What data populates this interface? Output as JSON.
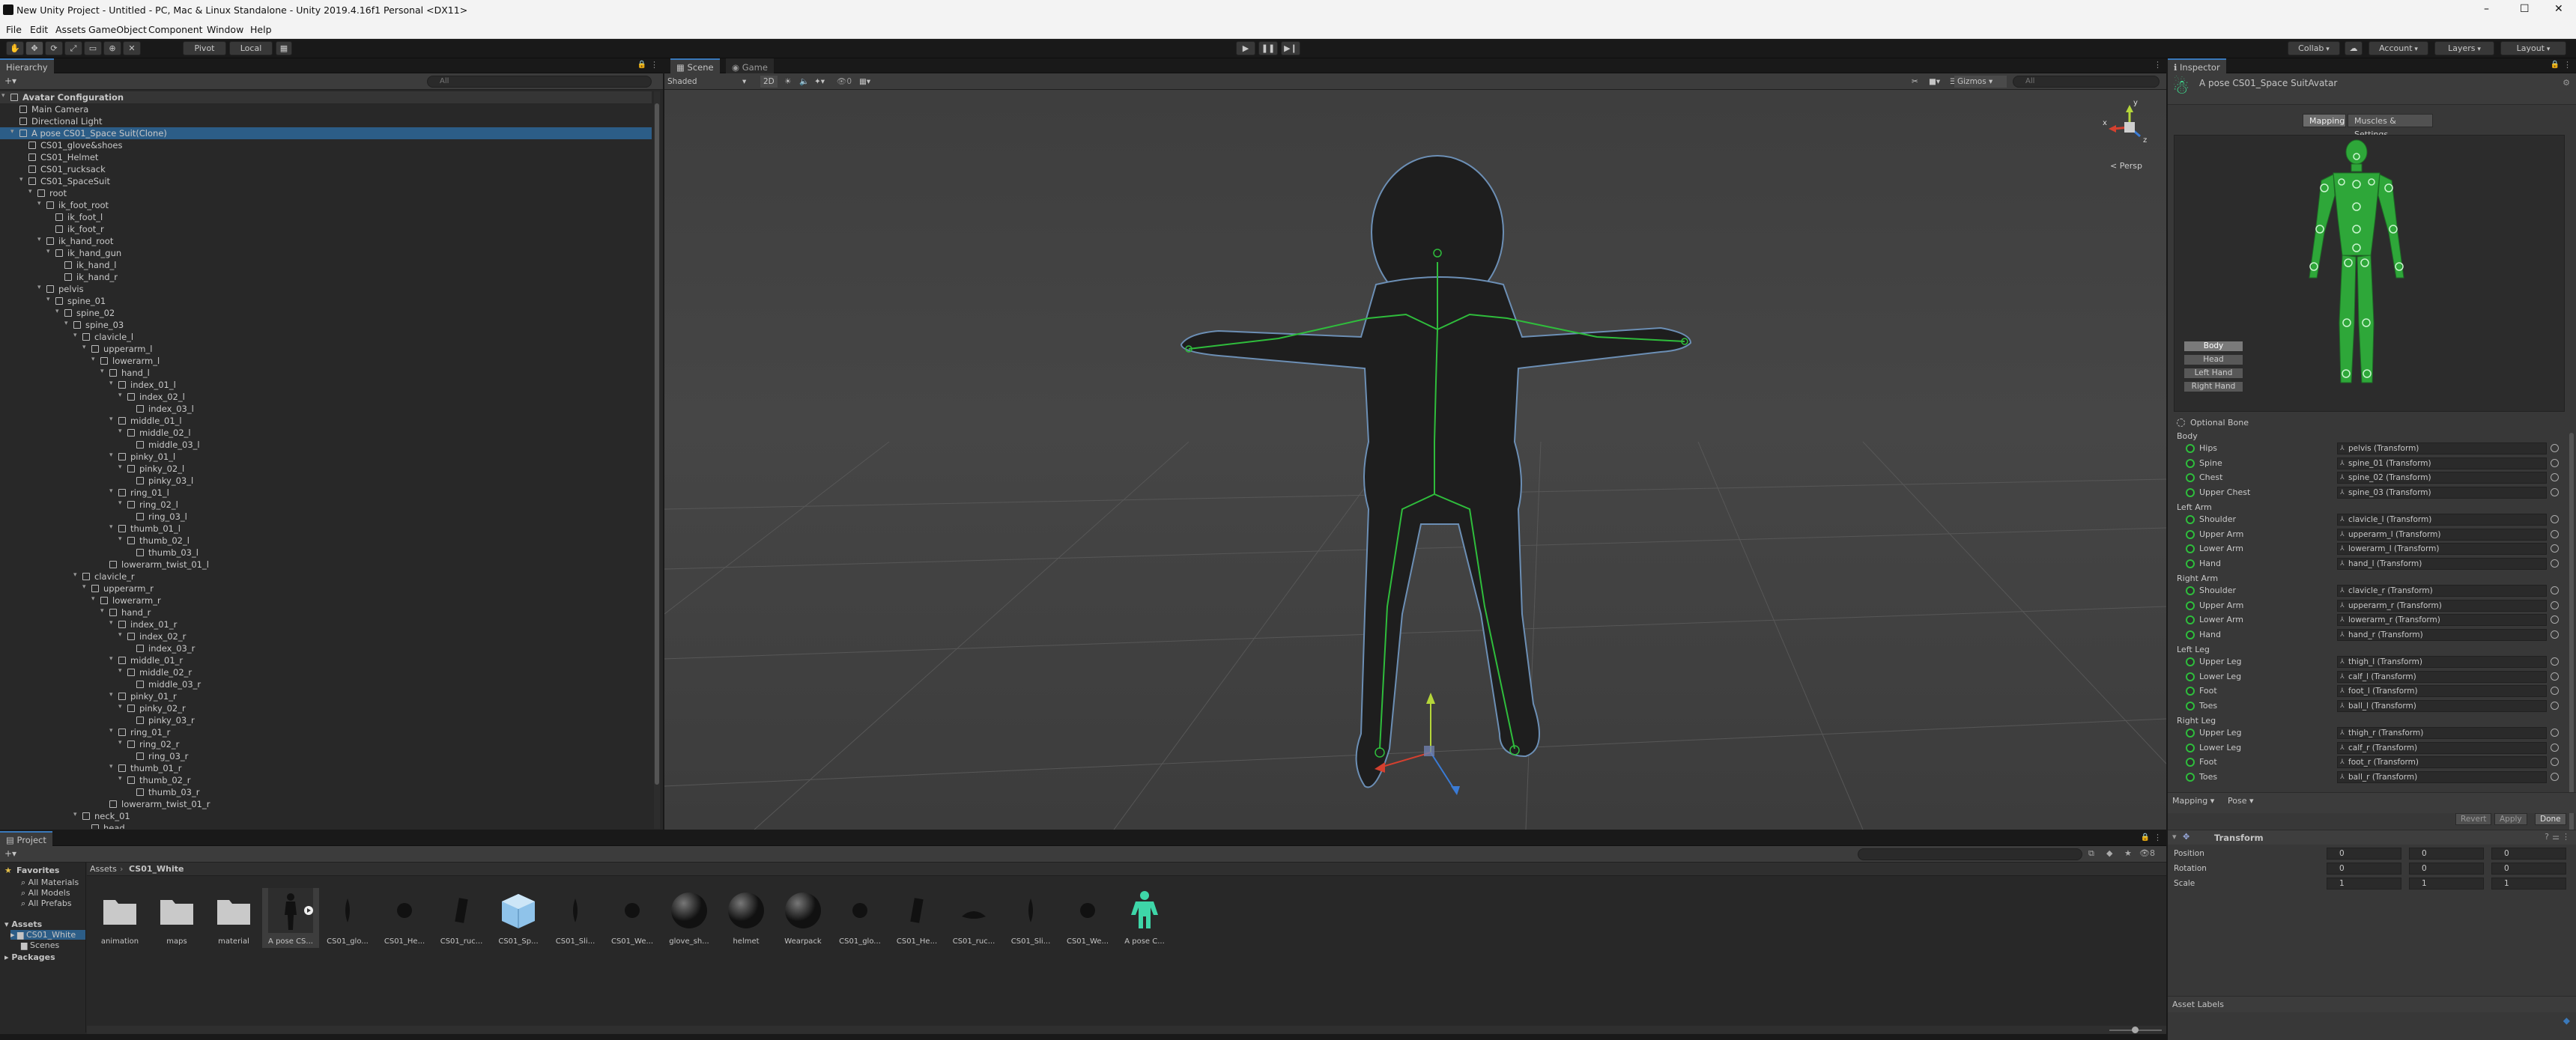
{
  "window": {
    "title": "New Unity Project - Untitled - PC, Mac & Linux Standalone - Unity 2019.4.16f1 Personal <DX11>",
    "controls": [
      "–",
      "☐",
      "✕"
    ]
  },
  "menu": [
    "File",
    "Edit",
    "Assets",
    "GameObject",
    "Component",
    "Window",
    "Help"
  ],
  "toolbar": {
    "pivot": "Pivot",
    "local": "Local",
    "collab": "Collab",
    "account": "Account",
    "layers": "Layers",
    "layout": "Layout"
  },
  "hierarchy": {
    "tab": "Hierarchy",
    "search_placeholder": "All",
    "rows": [
      {
        "label": "Avatar Configuration",
        "depth": 0,
        "expanded": true,
        "root": true
      },
      {
        "label": "Main Camera",
        "depth": 1
      },
      {
        "label": "Directional Light",
        "depth": 1
      },
      {
        "label": "A pose CS01_Space Suit(Clone)",
        "depth": 1,
        "expanded": true,
        "selected": true
      },
      {
        "label": "CS01_glove&shoes",
        "depth": 2
      },
      {
        "label": "CS01_Helmet",
        "depth": 2
      },
      {
        "label": "CS01_rucksack",
        "depth": 2
      },
      {
        "label": "CS01_SpaceSuit",
        "depth": 2,
        "expanded": true
      },
      {
        "label": "root",
        "depth": 3,
        "expanded": true
      },
      {
        "label": "ik_foot_root",
        "depth": 4,
        "expanded": true
      },
      {
        "label": "ik_foot_l",
        "depth": 5
      },
      {
        "label": "ik_foot_r",
        "depth": 5
      },
      {
        "label": "ik_hand_root",
        "depth": 4,
        "expanded": true
      },
      {
        "label": "ik_hand_gun",
        "depth": 5,
        "expanded": true
      },
      {
        "label": "ik_hand_l",
        "depth": 6
      },
      {
        "label": "ik_hand_r",
        "depth": 6
      },
      {
        "label": "pelvis",
        "depth": 4,
        "expanded": true
      },
      {
        "label": "spine_01",
        "depth": 5,
        "expanded": true
      },
      {
        "label": "spine_02",
        "depth": 6,
        "expanded": true
      },
      {
        "label": "spine_03",
        "depth": 7,
        "expanded": true
      },
      {
        "label": "clavicle_l",
        "depth": 8,
        "expanded": true
      },
      {
        "label": "upperarm_l",
        "depth": 9,
        "expanded": true
      },
      {
        "label": "lowerarm_l",
        "depth": 10,
        "expanded": true
      },
      {
        "label": "hand_l",
        "depth": 11,
        "expanded": true
      },
      {
        "label": "index_01_l",
        "depth": 12,
        "expanded": true
      },
      {
        "label": "index_02_l",
        "depth": 13,
        "expanded": true
      },
      {
        "label": "index_03_l",
        "depth": 14
      },
      {
        "label": "middle_01_l",
        "depth": 12,
        "expanded": true
      },
      {
        "label": "middle_02_l",
        "depth": 13,
        "expanded": true
      },
      {
        "label": "middle_03_l",
        "depth": 14
      },
      {
        "label": "pinky_01_l",
        "depth": 12,
        "expanded": true
      },
      {
        "label": "pinky_02_l",
        "depth": 13,
        "expanded": true
      },
      {
        "label": "pinky_03_l",
        "depth": 14
      },
      {
        "label": "ring_01_l",
        "depth": 12,
        "expanded": true
      },
      {
        "label": "ring_02_l",
        "depth": 13,
        "expanded": true
      },
      {
        "label": "ring_03_l",
        "depth": 14
      },
      {
        "label": "thumb_01_l",
        "depth": 12,
        "expanded": true
      },
      {
        "label": "thumb_02_l",
        "depth": 13,
        "expanded": true
      },
      {
        "label": "thumb_03_l",
        "depth": 14
      },
      {
        "label": "lowerarm_twist_01_l",
        "depth": 11
      },
      {
        "label": "clavicle_r",
        "depth": 8,
        "expanded": true
      },
      {
        "label": "upperarm_r",
        "depth": 9,
        "expanded": true
      },
      {
        "label": "lowerarm_r",
        "depth": 10,
        "expanded": true
      },
      {
        "label": "hand_r",
        "depth": 11,
        "expanded": true
      },
      {
        "label": "index_01_r",
        "depth": 12,
        "expanded": true
      },
      {
        "label": "index_02_r",
        "depth": 13,
        "expanded": true
      },
      {
        "label": "index_03_r",
        "depth": 14
      },
      {
        "label": "middle_01_r",
        "depth": 12,
        "expanded": true
      },
      {
        "label": "middle_02_r",
        "depth": 13,
        "expanded": true
      },
      {
        "label": "middle_03_r",
        "depth": 14
      },
      {
        "label": "pinky_01_r",
        "depth": 12,
        "expanded": true
      },
      {
        "label": "pinky_02_r",
        "depth": 13,
        "expanded": true
      },
      {
        "label": "pinky_03_r",
        "depth": 14
      },
      {
        "label": "ring_01_r",
        "depth": 12,
        "expanded": true
      },
      {
        "label": "ring_02_r",
        "depth": 13,
        "expanded": true
      },
      {
        "label": "ring_03_r",
        "depth": 14
      },
      {
        "label": "thumb_01_r",
        "depth": 12,
        "expanded": true
      },
      {
        "label": "thumb_02_r",
        "depth": 13,
        "expanded": true
      },
      {
        "label": "thumb_03_r",
        "depth": 14
      },
      {
        "label": "lowerarm_twist_01_r",
        "depth": 11
      },
      {
        "label": "neck_01",
        "depth": 8,
        "expanded": true
      },
      {
        "label": "head",
        "depth": 9
      }
    ]
  },
  "scene": {
    "tabs": [
      "Scene",
      "Game"
    ],
    "shading": "Shaded",
    "mode_2d": "2D",
    "gizmos": "Gizmos",
    "search_placeholder": "All",
    "fx_count": "0",
    "projection": "< Persp",
    "gizmo_axes": {
      "y": "y",
      "x": "x",
      "z": "z"
    }
  },
  "inspector": {
    "tab": "Inspector",
    "title": "A pose CS01_Space SuitAvatar",
    "tabs": [
      "Mapping",
      "Muscles & Settings"
    ],
    "body_buttons": [
      "Body",
      "Head",
      "Left Hand",
      "Right Hand"
    ],
    "optional_bone": "Optional Bone",
    "groups": [
      {
        "name": "Body",
        "bones": [
          {
            "name": "Hips",
            "transform": "pelvis (Transform)"
          },
          {
            "name": "Spine",
            "transform": "spine_01 (Transform)"
          },
          {
            "name": "Chest",
            "transform": "spine_02 (Transform)"
          },
          {
            "name": "Upper Chest",
            "transform": "spine_03 (Transform)"
          }
        ]
      },
      {
        "name": "Left Arm",
        "bones": [
          {
            "name": "Shoulder",
            "transform": "clavicle_l (Transform)"
          },
          {
            "name": "Upper Arm",
            "transform": "upperarm_l (Transform)"
          },
          {
            "name": "Lower Arm",
            "transform": "lowerarm_l (Transform)"
          },
          {
            "name": "Hand",
            "transform": "hand_l (Transform)"
          }
        ]
      },
      {
        "name": "Right Arm",
        "bones": [
          {
            "name": "Shoulder",
            "transform": "clavicle_r (Transform)"
          },
          {
            "name": "Upper Arm",
            "transform": "upperarm_r (Transform)"
          },
          {
            "name": "Lower Arm",
            "transform": "lowerarm_r (Transform)"
          },
          {
            "name": "Hand",
            "transform": "hand_r (Transform)"
          }
        ]
      },
      {
        "name": "Left Leg",
        "bones": [
          {
            "name": "Upper Leg",
            "transform": "thigh_l (Transform)"
          },
          {
            "name": "Lower Leg",
            "transform": "calf_l (Transform)"
          },
          {
            "name": "Foot",
            "transform": "foot_l (Transform)"
          },
          {
            "name": "Toes",
            "transform": "ball_l (Transform)"
          }
        ]
      },
      {
        "name": "Right Leg",
        "bones": [
          {
            "name": "Upper Leg",
            "transform": "thigh_r (Transform)"
          },
          {
            "name": "Lower Leg",
            "transform": "calf_r (Transform)"
          },
          {
            "name": "Foot",
            "transform": "foot_r (Transform)"
          },
          {
            "name": "Toes",
            "transform": "ball_r (Transform)"
          }
        ]
      }
    ],
    "mapping_dropdown": "Mapping",
    "pose_dropdown": "Pose",
    "revert": "Revert",
    "apply": "Apply",
    "done": "Done",
    "transform": {
      "title": "Transform",
      "position_label": "Position",
      "position": {
        "x": "0",
        "y": "0",
        "z": "0"
      },
      "rotation_label": "Rotation",
      "rotation": {
        "x": "0",
        "y": "0",
        "z": "0"
      },
      "scale_label": "Scale",
      "scale": {
        "x": "1",
        "y": "1",
        "z": "1"
      }
    },
    "asset_labels": "Asset Labels"
  },
  "project": {
    "tab": "Project",
    "favorites": "Favorites",
    "favorites_items": [
      "All Materials",
      "All Models",
      "All Prefabs"
    ],
    "assets_root": "Assets",
    "tree": [
      "CS01_White",
      "Scenes"
    ],
    "packages": "Packages",
    "breadcrumb": [
      "Assets",
      "CS01_White"
    ],
    "items": [
      {
        "label": "animation",
        "kind": "folder"
      },
      {
        "label": "maps",
        "kind": "folder"
      },
      {
        "label": "material",
        "kind": "folder"
      },
      {
        "label": "A pose CS...",
        "kind": "model",
        "selected": true
      },
      {
        "label": "CS01_glo...",
        "kind": "mesh"
      },
      {
        "label": "CS01_He...",
        "kind": "mesh"
      },
      {
        "label": "CS01_ruc...",
        "kind": "mesh"
      },
      {
        "label": "CS01_Sp...",
        "kind": "prefab"
      },
      {
        "label": "CS01_Sli...",
        "kind": "mesh"
      },
      {
        "label": "CS01_We...",
        "kind": "mesh"
      },
      {
        "label": "glove_sh...",
        "kind": "sphere"
      },
      {
        "label": "helmet",
        "kind": "sphere"
      },
      {
        "label": "Wearpack",
        "kind": "sphere"
      },
      {
        "label": "CS01_glo...",
        "kind": "mesh"
      },
      {
        "label": "CS01_He...",
        "kind": "mesh"
      },
      {
        "label": "CS01_ruc...",
        "kind": "mesh"
      },
      {
        "label": "CS01_Sli...",
        "kind": "mesh"
      },
      {
        "label": "CS01_We...",
        "kind": "mesh"
      },
      {
        "label": "A pose C...",
        "kind": "avatar"
      }
    ],
    "count_badge": "8"
  },
  "colors": {
    "accent_blue": "#3a79bb",
    "bone_green": "#2fbd3c",
    "selection": "#2c5d87"
  }
}
